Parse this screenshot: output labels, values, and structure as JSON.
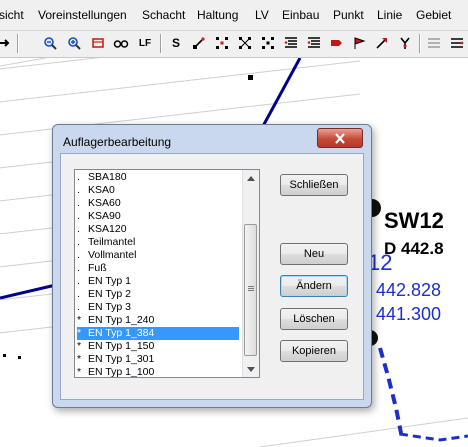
{
  "menu": {
    "items": [
      "sicht",
      "Voreinstellungen",
      "Schacht",
      "Haltung",
      "LV",
      "Einbau",
      "Punkt",
      "Linie",
      "Gebiet"
    ]
  },
  "toolbar": {
    "icons": [
      "arrow-icon",
      "zoom-out-icon",
      "zoom-in-icon",
      "zoom-window-icon",
      "glasses-icon",
      "lf-text-icon",
      "s-text-icon",
      "point-tool-1-icon",
      "point-tool-2-icon",
      "point-tool-3-icon",
      "point-tool-4-icon",
      "list-tool-1-icon",
      "list-tool-2-icon",
      "list-tool-3-icon",
      "red-marker-icon",
      "red-flag-icon",
      "red-arrow-icon",
      "fork-icon",
      "list-tool-4-icon",
      "list-tool-5-icon"
    ],
    "lf_label": "LF",
    "s_label": "S"
  },
  "canvas": {
    "labels": {
      "sw": "SW12",
      "d": "D 442.8",
      "partial": "12",
      "val1": "442.828",
      "val2": "441.300"
    },
    "colors": {
      "line_blue": "#00008b",
      "label_blue": "#1c2fcc",
      "grid": "#cfcfcf"
    }
  },
  "dialog": {
    "title": "Auflagerbearbeitung",
    "list": {
      "selected_index": 12,
      "items": [
        {
          "marker": ".",
          "label": "SBA180"
        },
        {
          "marker": ".",
          "label": "KSA0"
        },
        {
          "marker": ".",
          "label": "KSA60"
        },
        {
          "marker": ".",
          "label": "KSA90"
        },
        {
          "marker": ".",
          "label": "KSA120"
        },
        {
          "marker": ".",
          "label": "Teilmantel"
        },
        {
          "marker": ".",
          "label": "Vollmantel"
        },
        {
          "marker": ".",
          "label": "Fuß"
        },
        {
          "marker": ".",
          "label": "EN Typ 1"
        },
        {
          "marker": ".",
          "label": "EN Typ 2"
        },
        {
          "marker": ".",
          "label": "EN Typ 3"
        },
        {
          "marker": "*",
          "label": "EN Typ 1_240"
        },
        {
          "marker": "*",
          "label": "EN Typ 1_384"
        },
        {
          "marker": "*",
          "label": "EN Typ 1_150"
        },
        {
          "marker": "*",
          "label": "EN Typ 1_301"
        },
        {
          "marker": "*",
          "label": "EN Typ 1_100"
        }
      ]
    },
    "buttons": {
      "close_label": "Schließen",
      "new_label": "Neu",
      "change_label": "Ändern",
      "delete_label": "Löschen",
      "copy_label": "Kopieren"
    },
    "colors": {
      "selection": "#3399ff",
      "title_bg": "#c9d8ec"
    }
  }
}
